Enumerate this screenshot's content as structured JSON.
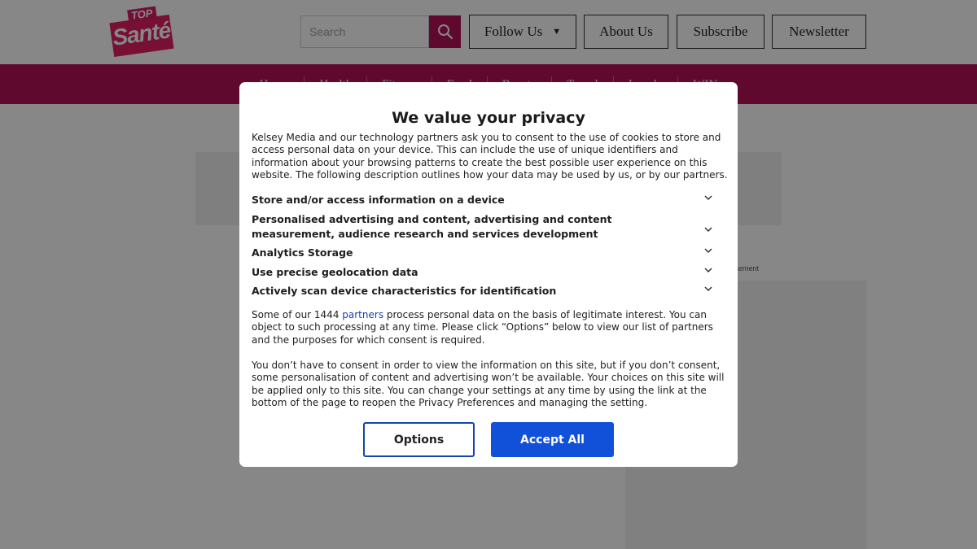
{
  "site": {
    "logo": {
      "top": "TOP",
      "main": "Santé"
    },
    "search": {
      "placeholder": "Search"
    },
    "header_buttons": {
      "follow_us": "Follow Us",
      "about_us": "About Us",
      "subscribe": "Subscribe",
      "newsletter": "Newsletter"
    },
    "nav": [
      "Home",
      "Health",
      "Fitness",
      "Food",
      "Beauty",
      "Travel",
      "Lovely",
      "WIN"
    ],
    "ad_label": "rtisement"
  },
  "consent": {
    "title": "We value your privacy",
    "intro": "Kelsey Media and our technology partners ask you to consent to the use of cookies to store and access personal data on your device. This can include the use of unique identifiers and information about your browsing patterns to create the best possible user experience on this website. The following description outlines how your data may be used by us, or by our partners.",
    "purposes": [
      "Store and/or access information on a device",
      "Personalised advertising and content, advertising and content measurement, audience research and services development",
      "Analytics Storage",
      "Use precise geolocation data",
      "Actively scan device characteristics for identification"
    ],
    "legit_before": "Some of our 1444 ",
    "legit_link": "partners",
    "legit_after": " process personal data on the basis of legitimate interest. You can object to such processing at any time. Please click “Options” below to view our list of partners and the purposes for which consent is required.",
    "no_consent": "You don’t have to consent in order to view the information on this site, but if you don’t consent, some personalisation of content and advertising won’t be available. Your choices on this site will be applied only to this site. You can change your settings at any time by using the link at the bottom of the page to reopen the Privacy Preferences and managing the setting.",
    "options_label": "Options",
    "accept_label": "Accept All"
  },
  "colors": {
    "brand": "#b3125a",
    "accept": "#1150d8",
    "link": "#1a3fb5"
  }
}
